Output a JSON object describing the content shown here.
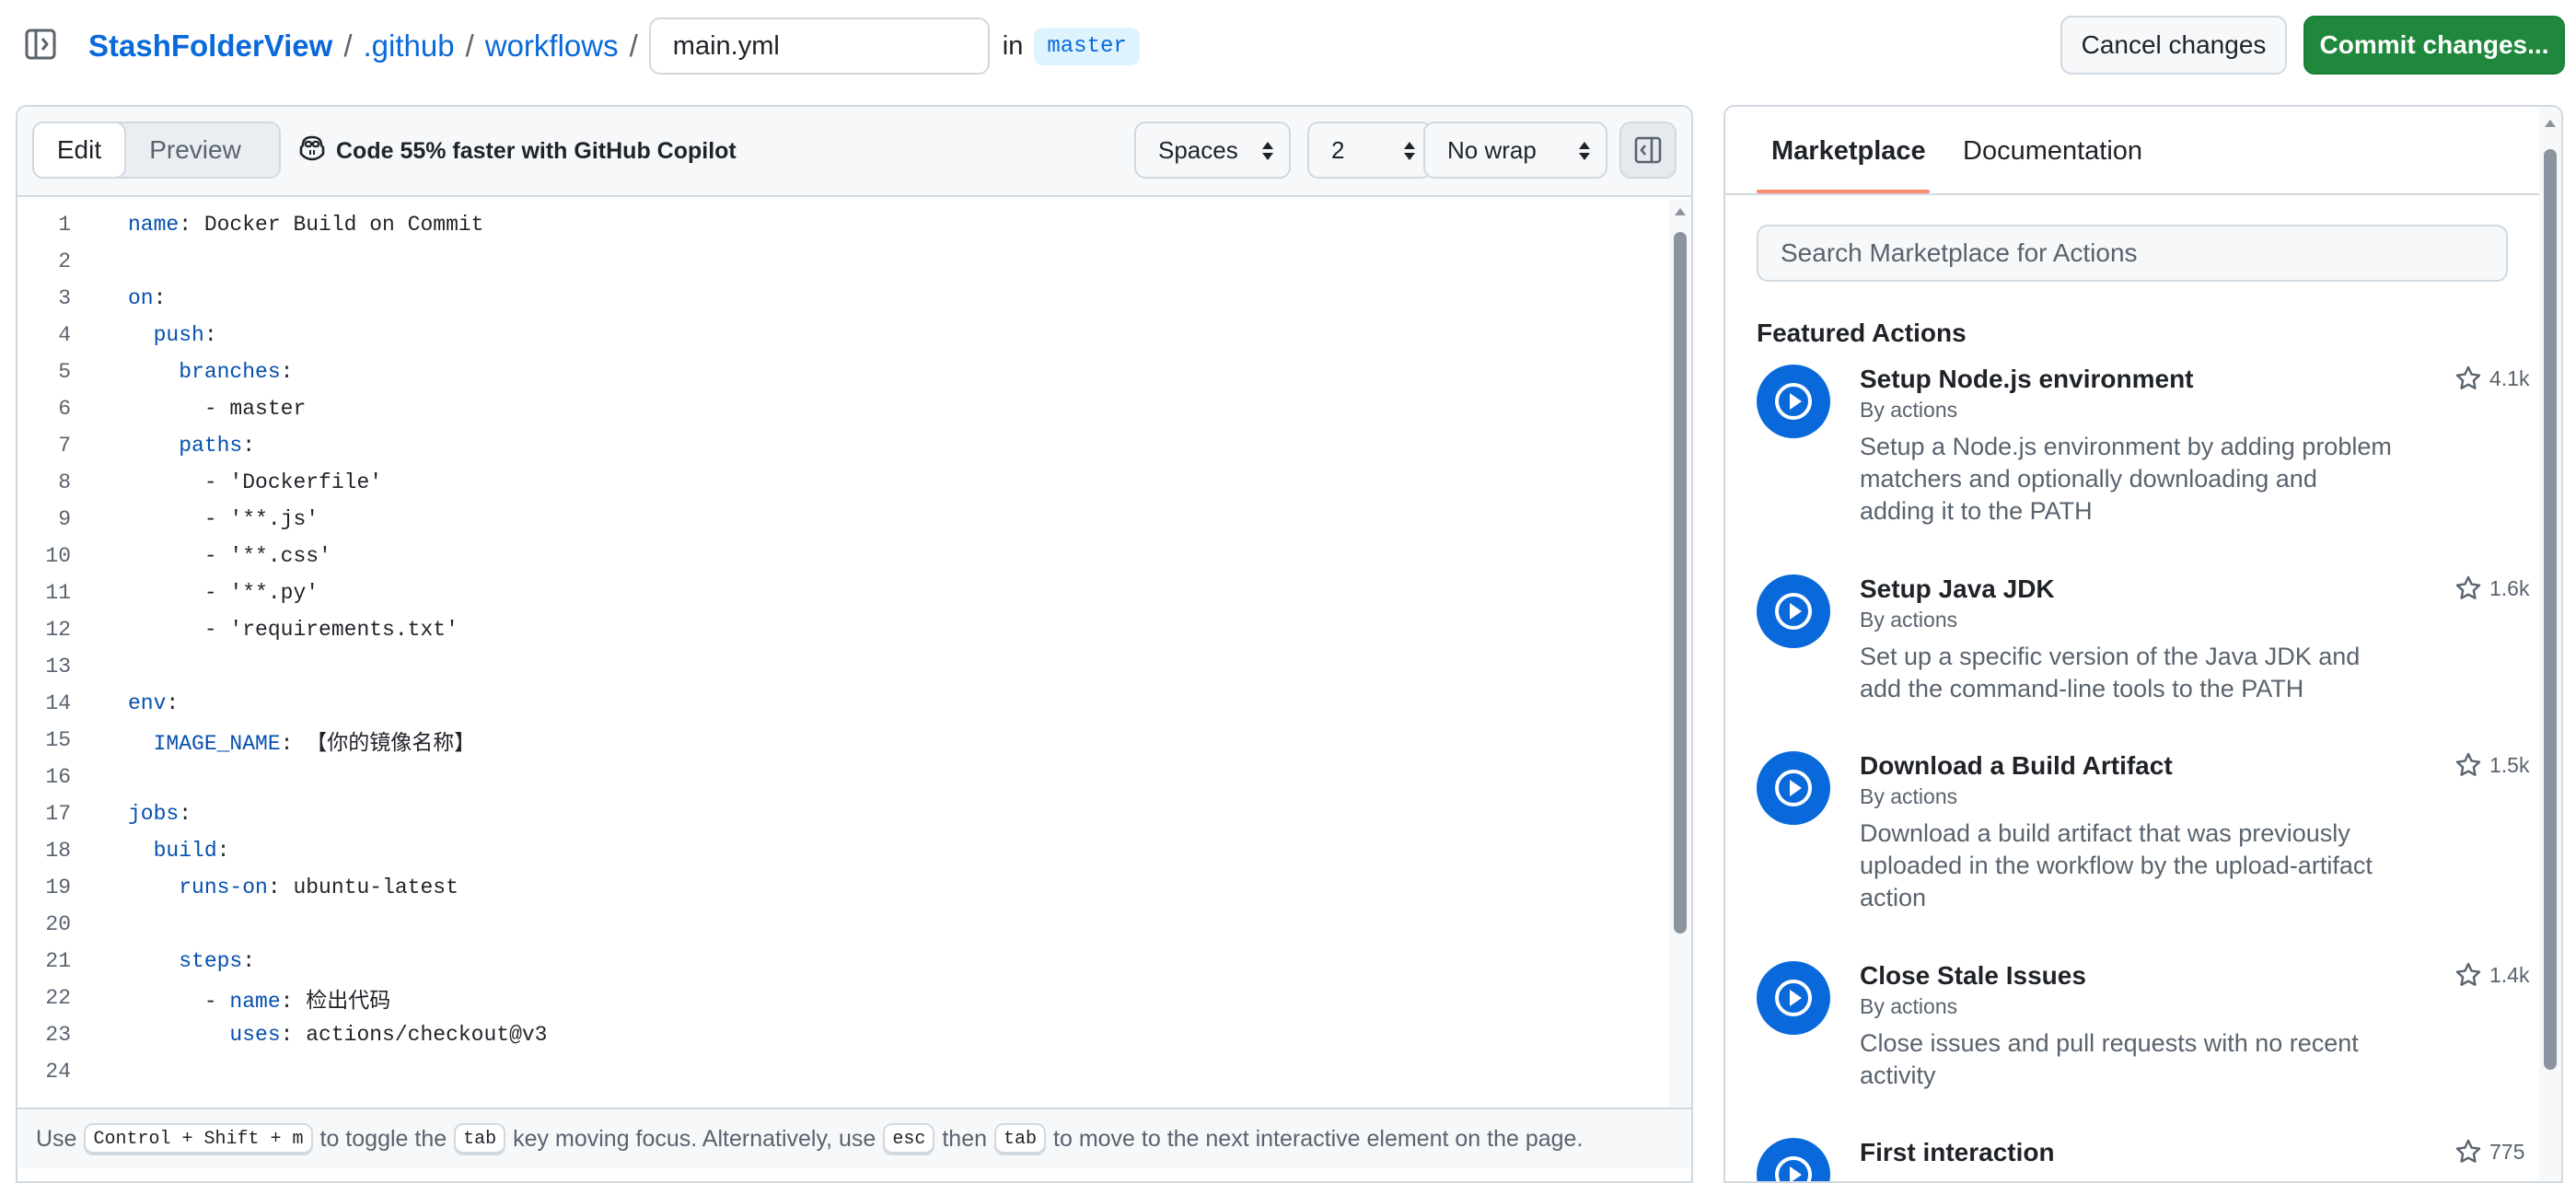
{
  "breadcrumb": {
    "repo": "StashFolderView",
    "sep1": "/",
    "folder1": ".github",
    "sep2": "/",
    "folder2": "workflows",
    "sep3": "/",
    "filename": "main.yml",
    "in_label": "in",
    "branch": "master"
  },
  "actions_bar": {
    "cancel_label": "Cancel changes",
    "commit_label": "Commit changes..."
  },
  "editor": {
    "tabs": {
      "edit": "Edit",
      "preview": "Preview"
    },
    "copilot_label": "Code 55% faster with GitHub Copilot",
    "indent_mode": "Spaces",
    "indent_size": "2",
    "wrap_mode": "No wrap",
    "lines": [
      {
        "n": "1",
        "k": "name",
        "v": ": Docker Build on Commit",
        "i": ""
      },
      {
        "n": "2",
        "k": "",
        "v": "",
        "i": ""
      },
      {
        "n": "3",
        "k": "on",
        "v": ":",
        "i": ""
      },
      {
        "n": "4",
        "k": "push",
        "v": ":",
        "i": "  "
      },
      {
        "n": "5",
        "k": "branches",
        "v": ":",
        "i": "    "
      },
      {
        "n": "6",
        "k": "",
        "v": "- master",
        "i": "      "
      },
      {
        "n": "7",
        "k": "paths",
        "v": ":",
        "i": "    "
      },
      {
        "n": "8",
        "k": "",
        "v": "- 'Dockerfile'",
        "i": "      "
      },
      {
        "n": "9",
        "k": "",
        "v": "- '**.js'",
        "i": "      "
      },
      {
        "n": "10",
        "k": "",
        "v": "- '**.css'",
        "i": "      "
      },
      {
        "n": "11",
        "k": "",
        "v": "- '**.py'",
        "i": "      "
      },
      {
        "n": "12",
        "k": "",
        "v": "- 'requirements.txt'",
        "i": "      "
      },
      {
        "n": "13",
        "k": "",
        "v": "",
        "i": ""
      },
      {
        "n": "14",
        "k": "env",
        "v": ":",
        "i": ""
      },
      {
        "n": "15",
        "k": "IMAGE_NAME",
        "v": ": 【你的镜像名称】",
        "i": "  "
      },
      {
        "n": "16",
        "k": "",
        "v": "",
        "i": ""
      },
      {
        "n": "17",
        "k": "jobs",
        "v": ":",
        "i": ""
      },
      {
        "n": "18",
        "k": "build",
        "v": ":",
        "i": "  "
      },
      {
        "n": "19",
        "k": "runs-on",
        "v": ": ubuntu-latest",
        "i": "    "
      },
      {
        "n": "20",
        "k": "",
        "v": "",
        "i": ""
      },
      {
        "n": "21",
        "k": "steps",
        "v": ":",
        "i": "    "
      },
      {
        "n": "22",
        "k": "name",
        "v": ": 检出代码",
        "i": "      - "
      },
      {
        "n": "23",
        "k": "uses",
        "v": ": actions/checkout@v3",
        "i": "        "
      },
      {
        "n": "24",
        "k": "",
        "v": "",
        "i": ""
      }
    ],
    "footer": {
      "t1": "Use",
      "k1": "Control + Shift + m",
      "t2": "to toggle the",
      "k2": "tab",
      "t3": "key moving focus. Alternatively, use",
      "k3": "esc",
      "t4": "then",
      "k4": "tab",
      "t5": "to move to the next interactive element on the page."
    }
  },
  "marketplace": {
    "tabs": {
      "marketplace": "Marketplace",
      "documentation": "Documentation"
    },
    "search_placeholder": "Search Marketplace for Actions",
    "featured_title": "Featured Actions",
    "actions": [
      {
        "name": "Setup Node.js environment",
        "by": "By actions",
        "desc": "Setup a Node.js environment by adding problem matchers and optionally downloading and adding it to the PATH",
        "stars": "4.1k"
      },
      {
        "name": "Setup Java JDK",
        "by": "By actions",
        "desc": "Set up a specific version of the Java JDK and add the command-line tools to the PATH",
        "stars": "1.6k"
      },
      {
        "name": "Download a Build Artifact",
        "by": "By actions",
        "desc": "Download a build artifact that was previously uploaded in the workflow by the upload-artifact action",
        "stars": "1.5k"
      },
      {
        "name": "Close Stale Issues",
        "by": "By actions",
        "desc": "Close issues and pull requests with no recent activity",
        "stars": "1.4k"
      },
      {
        "name": "First interaction",
        "by": "",
        "desc": "",
        "stars": "775"
      }
    ]
  },
  "colors": {
    "accent": "#0969da",
    "commit_green": "#1f883d",
    "tab_underline": "#fd8c73",
    "yaml_key": "#0550ae"
  }
}
